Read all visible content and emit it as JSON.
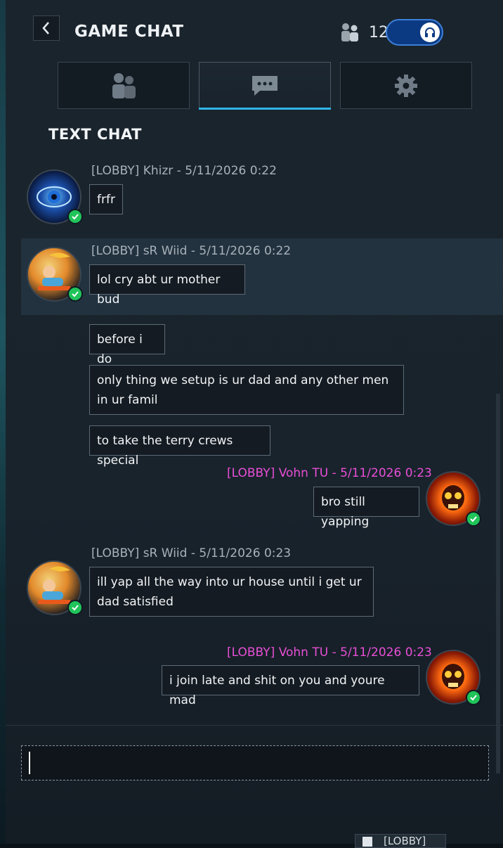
{
  "header": {
    "title": "GAME CHAT",
    "user_count": "12"
  },
  "tabs": [
    {
      "name": "users-tab",
      "icon": "users-icon"
    },
    {
      "name": "chat-tab",
      "icon": "chat-bubble-icon",
      "active": true
    },
    {
      "name": "settings-tab",
      "icon": "gear-icon"
    }
  ],
  "section_title": "TEXT CHAT",
  "messages": [
    {
      "header": "[LOBBY] Khizr - 5/11/2026 0:22",
      "lines": [
        "frfr"
      ],
      "side": "left",
      "avatar": "eye-avatar"
    },
    {
      "header": "[LOBBY] sR Wiid - 5/11/2026 0:22",
      "lines": [
        "lol cry abt ur mother bud",
        "before i do",
        "only thing we setup is ur dad and any other men in ur famil​t",
        "to take the terry crews special"
      ],
      "side": "left",
      "avatar": "beach-avatar"
    },
    {
      "header": "[LOBBY] Vohn TU - 5/11/2026 0:23",
      "lines": [
        "bro still yapping"
      ],
      "side": "right",
      "avatar": "flame-skull-avatar"
    },
    {
      "header": "[LOBBY] sR Wiid - 5/11/2026 0:23",
      "lines": [
        "ill yap all the way into ur house until i get ur dad satisfied"
      ],
      "side": "left",
      "avatar": "beach-avatar"
    },
    {
      "header": "[LOBBY] Vohn TU - 5/11/2026 0:23",
      "lines": [
        "i join late and shit on you and youre  mad"
      ],
      "side": "right",
      "avatar": "flame-skull-avatar"
    }
  ],
  "bubbles": {
    "m1": "frfr",
    "m2a": "lol cry abt ur mother bud",
    "m2b": "before i do",
    "m2c": "only thing we setup is ur dad and any other men in ur famil",
    "m2c_wrap": "famil",
    "m2d": "to take the terry crews special",
    "m3": "bro still yapping",
    "m4": "ill yap all the way into ur house until i get ur dad satisfied",
    "m5": "i join late and shit on you and youre  mad"
  },
  "input": {
    "value": ""
  },
  "footer": {
    "channel_tag": "[LOBBY]"
  },
  "colors": {
    "accent": "#2fb6e8",
    "toggle": "#0b3a82",
    "online": "#20c45a",
    "own_name": "#e84fd6"
  }
}
